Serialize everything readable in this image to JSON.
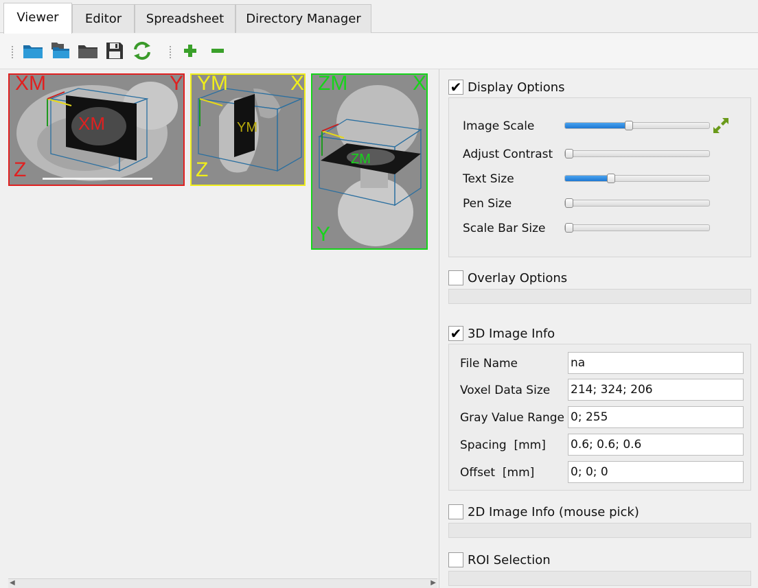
{
  "tabs": [
    {
      "label": "Viewer",
      "active": true
    },
    {
      "label": "Editor",
      "active": false
    },
    {
      "label": "Spreadsheet",
      "active": false
    },
    {
      "label": "Directory Manager",
      "active": false
    }
  ],
  "toolbar": {
    "icons": [
      "open-folder-icon",
      "open-multiple-icon",
      "folder-icon",
      "save-icon",
      "refresh-icon",
      "add-icon",
      "remove-icon"
    ]
  },
  "viewer": {
    "tiles": [
      {
        "id": "x",
        "title": "XM",
        "corner_right": "Y",
        "corner_bottom": "Z",
        "slice_label": "XM",
        "color": "#e02020"
      },
      {
        "id": "y",
        "title": "YM",
        "corner_right": "X",
        "corner_bottom": "Z",
        "slice_label": "YM",
        "color": "#f0ee1a"
      },
      {
        "id": "z",
        "title": "ZM",
        "corner_right": "X",
        "corner_bottom": "Y",
        "slice_label": "ZM",
        "color": "#16d41a"
      }
    ]
  },
  "display_options": {
    "title": "Display Options",
    "checked": true,
    "items": [
      {
        "label": "Image Scale",
        "value": 0.44
      },
      {
        "label": "Adjust Contrast",
        "value": 0.0
      },
      {
        "label": "Text Size",
        "value": 0.31
      },
      {
        "label": "Pen Size",
        "value": 0.0
      },
      {
        "label": "Scale Bar Size",
        "value": 0.0
      }
    ],
    "expand_icon": "expand-arrows-icon"
  },
  "overlay_options": {
    "title": "Overlay Options",
    "checked": false
  },
  "image_info_3d": {
    "title": "3D Image Info",
    "checked": true,
    "rows": [
      {
        "label": "File Name",
        "value": "na"
      },
      {
        "label": "Voxel Data Size",
        "value": "214; 324; 206"
      },
      {
        "label": "Gray Value Range",
        "value": "0; 255"
      },
      {
        "label": "Spacing  [mm]",
        "value": "0.6; 0.6; 0.6"
      },
      {
        "label": "Offset  [mm]",
        "value": "0; 0; 0"
      }
    ]
  },
  "image_info_2d": {
    "title": "2D Image Info (mouse pick)",
    "checked": false
  },
  "roi_selection": {
    "title": "ROI Selection",
    "checked": false
  },
  "check_glyph": "✔"
}
